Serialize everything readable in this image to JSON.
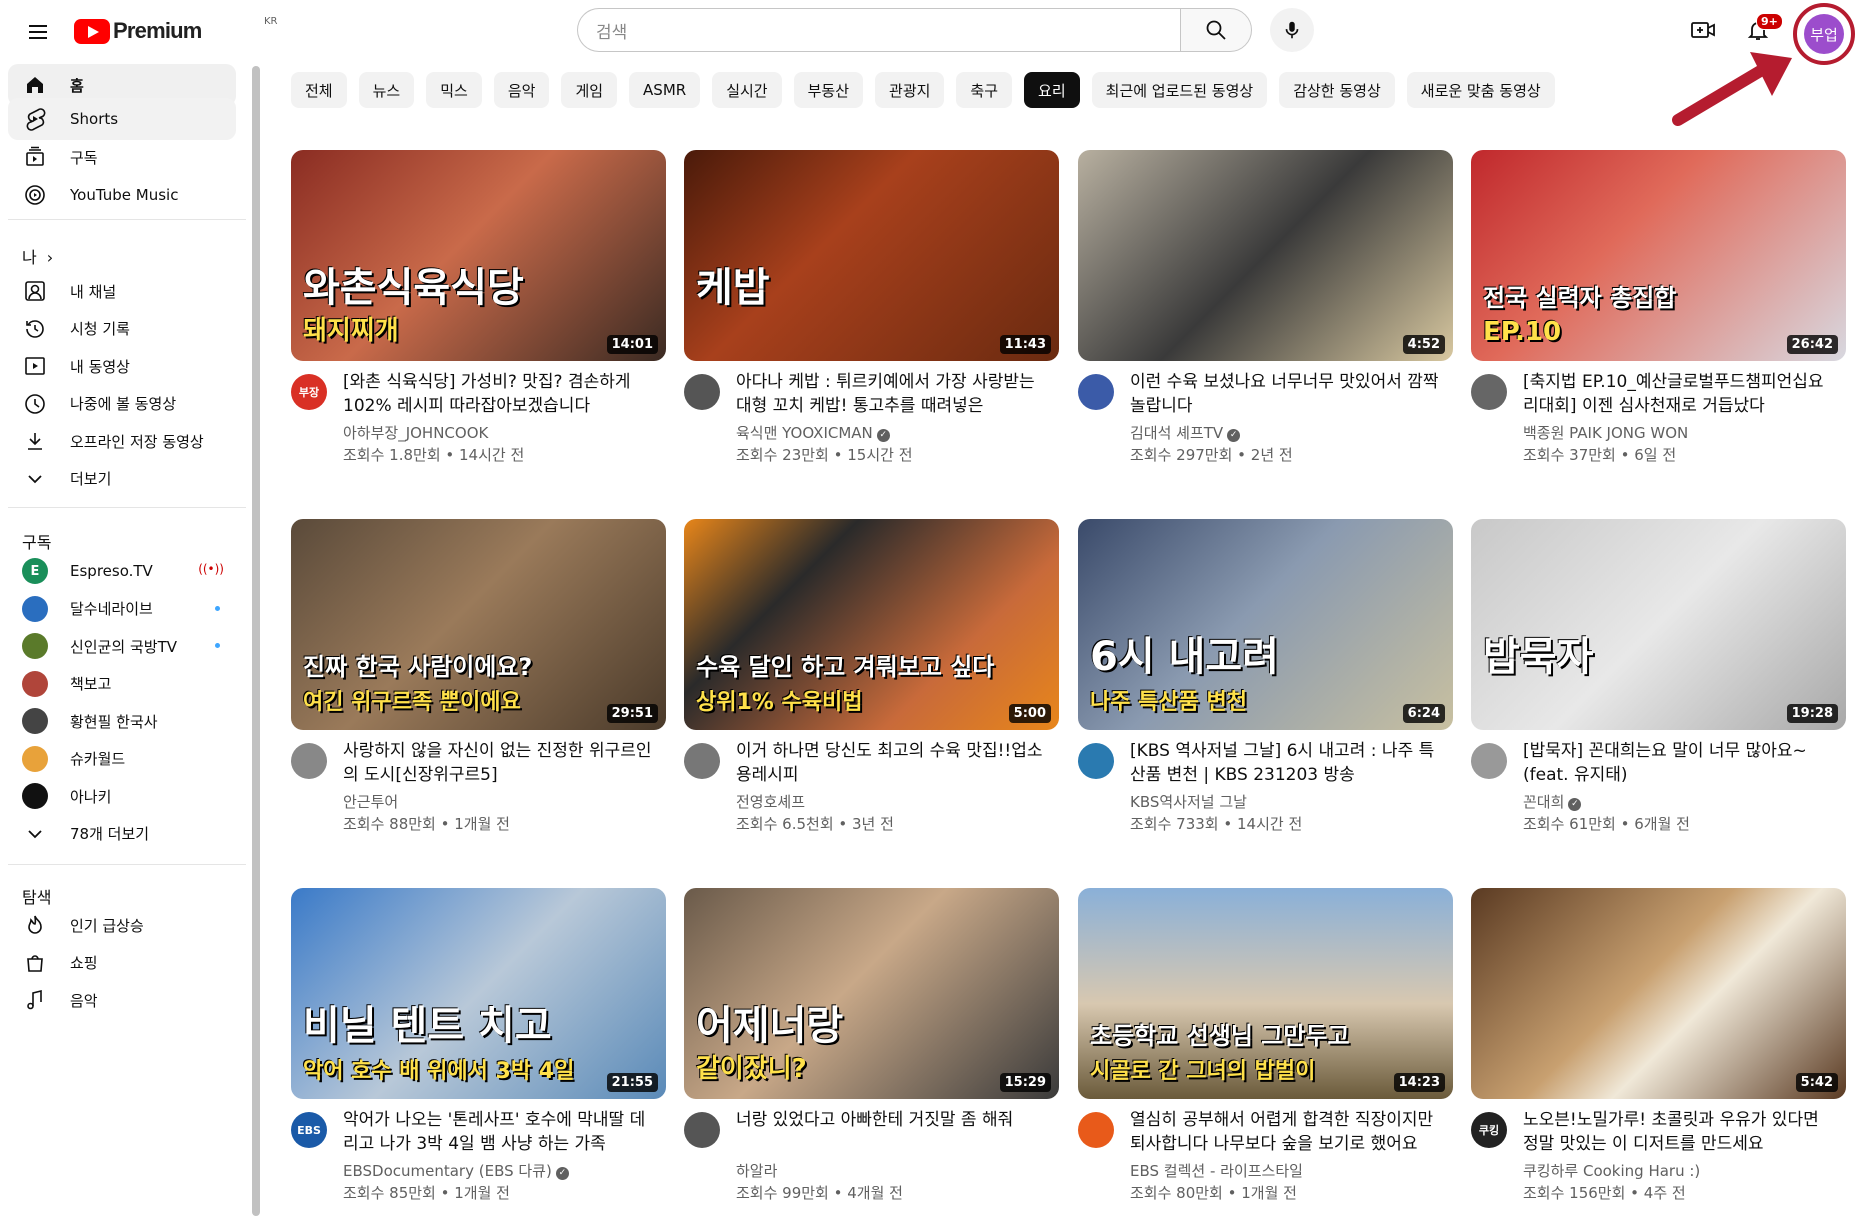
{
  "header": {
    "logo_text": "Premium",
    "region": "KR",
    "search_placeholder": "검색",
    "notification_count": "9+",
    "avatar_text": "부업"
  },
  "sidebar": {
    "main": [
      {
        "label": "홈",
        "icon": "home-icon"
      },
      {
        "label": "Shorts",
        "icon": "shorts-icon"
      },
      {
        "label": "구독",
        "icon": "subscriptions-icon"
      },
      {
        "label": "YouTube Music",
        "icon": "youtube-music-icon"
      }
    ],
    "you_title": "나",
    "you": [
      {
        "label": "내 채널",
        "icon": "channel-icon"
      },
      {
        "label": "시청 기록",
        "icon": "history-icon"
      },
      {
        "label": "내 동영상",
        "icon": "your-videos-icon"
      },
      {
        "label": "나중에 볼 동영상",
        "icon": "watch-later-icon"
      },
      {
        "label": "오프라인 저장 동영상",
        "icon": "downloads-icon"
      },
      {
        "label": "더보기",
        "icon": "chevron-down-icon"
      }
    ],
    "subs_title": "구독",
    "subs": [
      {
        "label": "Espreso.TV",
        "color": "#1a8f5a",
        "initial": "E"
      },
      {
        "label": "달수네라이브",
        "color": "#2a6ebf",
        "initial": ""
      },
      {
        "label": "신인균의 국방TV",
        "color": "#5a7a2a",
        "initial": ""
      },
      {
        "label": "책보고",
        "color": "#b0453a",
        "initial": ""
      },
      {
        "label": "황현필 한국사",
        "color": "#444444",
        "initial": ""
      },
      {
        "label": "슈카월드",
        "color": "#e8a23a",
        "initial": ""
      },
      {
        "label": "아나키",
        "color": "#111111",
        "initial": ""
      },
      {
        "label": "78개 더보기",
        "color": "",
        "initial": ""
      }
    ],
    "explore_title": "탐색",
    "explore": [
      {
        "label": "인기 급상승",
        "icon": "trending-icon"
      },
      {
        "label": "쇼핑",
        "icon": "shopping-icon"
      },
      {
        "label": "음악",
        "icon": "music-icon"
      }
    ]
  },
  "chips": [
    "전체",
    "뉴스",
    "믹스",
    "음악",
    "게임",
    "ASMR",
    "실시간",
    "부동산",
    "관광지",
    "축구",
    "요리",
    "최근에 업로드된 동영상",
    "감상한 동영상",
    "새로운 맞춤 동영상"
  ],
  "active_chip": 10,
  "videos": [
    {
      "title": "[와촌 식육식당] 가성비? 맛집? 겸손하게 102% 레시피 따라잡아보겠습니다",
      "channel": "아하부장_JOHNCOOK",
      "meta": "조회수 1.8만회 • 14시간 전",
      "duration": "14:01",
      "thumb_text": "와촌식육식당",
      "thumb_text2": "돼지찌개",
      "bg": "linear-gradient(135deg,#8a2c22,#c96a4a 45%,#3a2a22)",
      "av_color": "#d93025",
      "av_text": "부장",
      "verified": false
    },
    {
      "title": "아다나 케밥 : 튀르키예에서 가장 사랑받는 대형 꼬치 케밥! 통고추를 때려넣은",
      "channel": "육식맨 YOOXICMAN",
      "meta": "조회수 23만회 • 15시간 전",
      "duration": "11:43",
      "thumb_text": "케밥",
      "thumb_text2": "",
      "bg": "linear-gradient(135deg,#4a1a0a,#a8401c 40%,#6a2a10)",
      "av_color": "#555555",
      "av_text": "",
      "verified": true
    },
    {
      "title": "이런 수육 보셨나요 너무너무 맛있어서 깜짝 놀랍니다",
      "channel": "김대석 셰프TV",
      "meta": "조회수 297만회 • 2년 전",
      "duration": "4:52",
      "thumb_text": "",
      "thumb_text2": "",
      "bg": "linear-gradient(135deg,#b8b0a0,#3a3a3a 50%,#d8c8a0)",
      "av_color": "#3b5ba8",
      "av_text": "",
      "verified": true
    },
    {
      "title": "[축지법 EP.10_예산글로벌푸드챔피언십요리대회] 이젠 심사천재로 거듭났다",
      "channel": "백종원 PAIK JONG WON",
      "meta": "조회수 37만회 • 6일 전",
      "duration": "26:42",
      "thumb_text": "전국 실력자 총집합",
      "thumb_text2": "EP.10",
      "bg": "linear-gradient(135deg,#c0282c,#e06a5a 40%,#d8d8e0)",
      "av_color": "#666666",
      "av_text": "",
      "verified": false
    },
    {
      "title": "사랑하지 않을 자신이 없는 진정한 위구르인의 도시[신장위구르5]",
      "channel": "안근투어",
      "meta": "조회수 88만회 • 1개월 전",
      "duration": "29:51",
      "thumb_text": "진짜 한국 사람이에요?",
      "thumb_text2": "여긴 위구르족 뿐이에요",
      "bg": "linear-gradient(135deg,#5a4a3a,#9a7a5a 45%,#4a3a2a)",
      "av_color": "#888888",
      "av_text": "",
      "verified": false
    },
    {
      "title": "이거 하나면 당신도 최고의 수육 맛집!!업소용레시피",
      "channel": "전영호셰프",
      "meta": "조회수 6.5천회 • 3년 전",
      "duration": "5:00",
      "thumb_text": "수육 달인 하고 겨뤄보고 싶다",
      "thumb_text2": "상위1% 수육비법",
      "bg": "linear-gradient(135deg,#e8861a,#2a2a2a 30%,#c86a3a 70%,#e8861a)",
      "av_color": "#777777",
      "av_text": "",
      "verified": false
    },
    {
      "title": "[KBS 역사저널 그날] 6시 내고려 : 나주 특산품 변천 | KBS 231203 방송",
      "channel": "KBS역사저널 그날",
      "meta": "조회수 733회 • 14시간 전",
      "duration": "6:24",
      "thumb_text": "6시 내고려",
      "thumb_text2": "나주 특산품 변천",
      "bg": "linear-gradient(135deg,#3a4a6a,#8a9ab0 45%,#c8c0a0)",
      "av_color": "#2a7ab0",
      "av_text": "",
      "verified": false
    },
    {
      "title": "[밥묵자] 꼰대희는요 말이 너무 많아요~ (feat. 유지태)",
      "channel": "꼰대희",
      "meta": "조회수 61만회 • 6개월 전",
      "duration": "19:28",
      "thumb_text": "밥묵자",
      "thumb_text2": "",
      "bg": "linear-gradient(135deg,#c8c8c8,#e8e8e8 50%,#a8a8a8)",
      "av_color": "#999999",
      "av_text": "",
      "verified": true
    },
    {
      "title": "악어가 나오는 '톤레사프' 호수에 막내딸 데리고 나가 3박 4일 뱀 사냥 하는 가족",
      "channel": "EBSDocumentary (EBS 다큐)",
      "meta": "조회수 85만회 • 1개월 전",
      "duration": "21:55",
      "thumb_text": "비닐 텐트 치고",
      "thumb_text2": "악어 호수 배 위에서 3박 4일",
      "bg": "linear-gradient(135deg,#3a7ac8,#b8c8d8 50%,#5a8ab8)",
      "av_color": "#1a5aa8",
      "av_text": "EBS",
      "verified": true
    },
    {
      "title": "너랑 있었다고 아빠한테 거짓말 좀 해줘",
      "channel": "하알라",
      "meta": "조회수 99만회 • 4개월 전",
      "duration": "15:29",
      "thumb_text": "어제너랑",
      "thumb_text2": "같이잤니?",
      "bg": "linear-gradient(135deg,#6a5a4a,#c8a888 45%,#3a3a3a)",
      "av_color": "#555555",
      "av_text": "",
      "verified": false
    },
    {
      "title": "열심히 공부해서 어렵게 합격한 직장이지만 퇴사합니다 나무보다 숲을 보기로 했어요",
      "channel": "EBS 컬렉션 - 라이프스타일",
      "meta": "조회수 80만회 • 1개월 전",
      "duration": "14:23",
      "thumb_text": "초등학교 선생님 그만두고",
      "thumb_text2": "시골로 간 그녀의 밥벌이",
      "bg": "linear-gradient(180deg,#8ab0d8,#d8c8b0 55%,#6a5a3a)",
      "av_color": "#e85a1a",
      "av_text": "",
      "verified": false
    },
    {
      "title": "노오븐!노밀가루! 초콜릿과 우유가 있다면 정말 맛있는 이 디저트를 만드세요",
      "channel": "쿠킹하루 Cooking Haru :)",
      "meta": "조회수 156만회 • 4주 전",
      "duration": "5:42",
      "thumb_text": "",
      "thumb_text2": "",
      "bg": "linear-gradient(135deg,#5a3a22,#c8a070 45%,#f0e8d8 60%,#5a3a22)",
      "av_color": "#222222",
      "av_text": "쿠킹",
      "verified": false
    }
  ]
}
